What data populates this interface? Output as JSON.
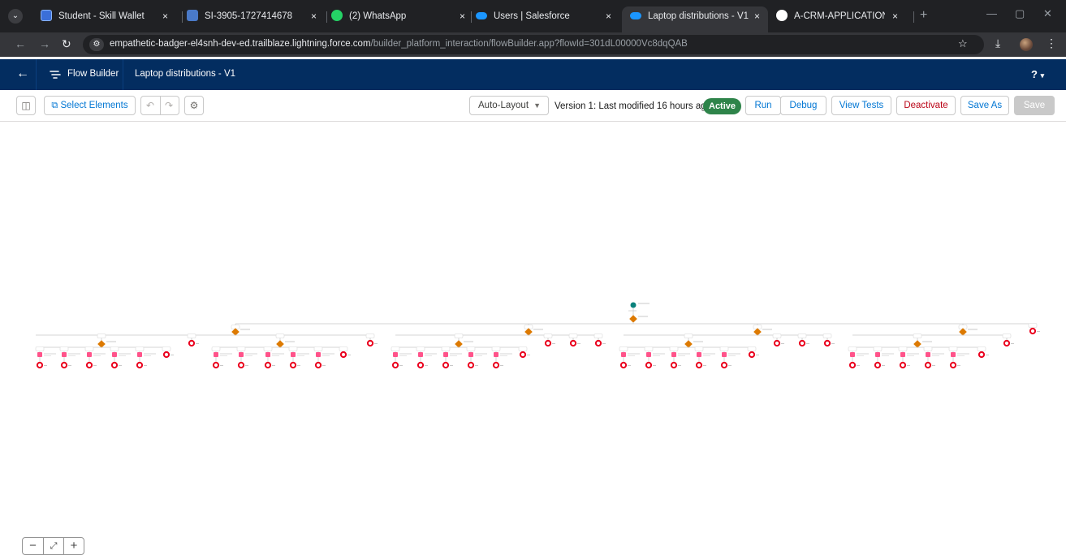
{
  "browser": {
    "tabs": [
      {
        "title": "Student - Skill Wallet",
        "favicon_color": "#3b6fd8"
      },
      {
        "title": "SI-3905-1727414678",
        "favicon_color": "#4a7ac8"
      },
      {
        "title": "(2) WhatsApp",
        "favicon_color": "#25d366"
      },
      {
        "title": "Users | Salesforce",
        "favicon_color": "#1b96ff"
      },
      {
        "title": "Laptop distributions - V1",
        "favicon_color": "#1b96ff"
      },
      {
        "title": "A-CRM-APPLICATION-FOR-L",
        "favicon_color": "#ffffff"
      }
    ],
    "tab_close": "×",
    "url_host": "empathetic-badger-el4snh-dev-ed.trailblaze.lightning.force.com",
    "url_path": "/builder_platform_interaction/flowBuilder.app?flowId=301dL00000Vc8dqQAB"
  },
  "sf_header": {
    "app_name": "Flow Builder",
    "flow_title": "Laptop distributions - V1",
    "help_label": "?",
    "brand_color": "#032d60"
  },
  "toolbar": {
    "select_elements": "Select Elements",
    "layout_mode": "Auto-Layout",
    "version_info": "Version 1: Last modified 16 hours ago",
    "status_badge": "Active",
    "run": "Run",
    "debug": "Debug",
    "view_tests": "View Tests",
    "deactivate": "Deactivate",
    "save_as": "Save As",
    "save": "Save"
  },
  "canvas": {
    "colors": {
      "start": "#0b827c",
      "decision": "#dd7a01",
      "assignment": "#ff538a",
      "end": "#ea001e",
      "connector": "#c9c9c9"
    }
  },
  "zoom": {
    "zoom_out": "−",
    "fit": "⤢",
    "zoom_in": "+"
  }
}
